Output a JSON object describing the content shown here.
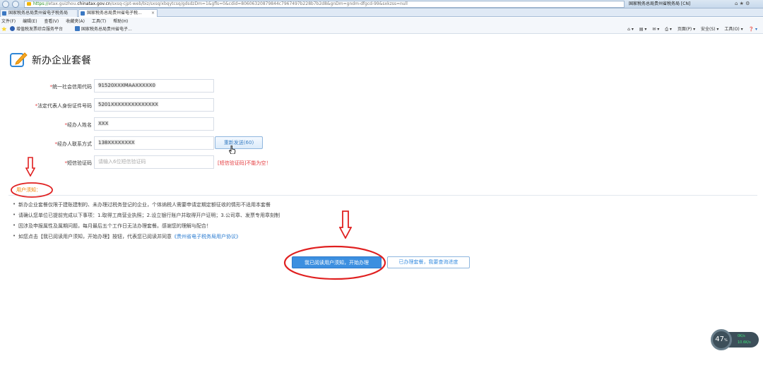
{
  "browser": {
    "url_scheme": "https://",
    "url_domain_prefix": "etax.guizhou.",
    "url_domain": "chinatax.gov.cn",
    "url_rest": "/sxsq-cjpt-web/biz/sxsq/xbqytcsq/gdsdzDm=1&gfls=0&cdid=80606320879844c7967497b228b7b2d8&gnDm=gndm-dfgcd-99&sxkzss=null",
    "site_name": "国家税务总局贵州省税务局 [CN]",
    "tabs": [
      {
        "label": "国家税务总局贵州省电子税务局"
      },
      {
        "label": "国家税务总局贵州省电子税..."
      }
    ],
    "menu": [
      "文件(F)",
      "编辑(E)",
      "查看(V)",
      "收藏夹(A)",
      "工具(T)",
      "帮助(H)"
    ],
    "favorites": [
      "增值税发票综合服务平台",
      "国家税务总局贵州省电子..."
    ],
    "commands": [
      "页面(P) ▾",
      "安全(S) ▾",
      "工具(O) ▾"
    ]
  },
  "page": {
    "title": "新办企业套餐",
    "fields": [
      {
        "label": "统一社会信用代码",
        "value": "91520XXXMAAXXXXX0"
      },
      {
        "label": "法定代表人身份证件号码",
        "value": "5201XXXXXXXXXXXXXX"
      },
      {
        "label": "经办人姓名",
        "value": "XXX"
      },
      {
        "label": "经办人联系方式",
        "value": "138XXXXXXXX"
      },
      {
        "label": "短信验证码",
        "value": "",
        "placeholder": "请输入6位短信验证码"
      }
    ],
    "required_mark": "*",
    "resend_button": "重新发送(60)",
    "sms_error": "[短信验证码]不能为空！",
    "notice_title": "用户须知：",
    "notices": [
      "新办企业套餐仅限于建账建制的、未办理过税务登记的企业，个体纳税人需要申请定期定额征收的情形不适用本套餐",
      "请确认您单位已提前完成以下事项：1.取得工商营业执照；2.设立银行账户并取得开户证明；3.公司章、发票专用章刻制",
      "因涉及申报属性及属期问题，每月最后五个工作日无法办理套餐。感谢您的理解与配合！"
    ],
    "notice_last_prefix": "如您点击【我已阅读用户须知，开始办理】按钮，代表您已阅读并同意",
    "notice_last_link": "《贵州省电子税务局用户协议》",
    "primary_button": "我已阅读用户须知，开始办理",
    "secondary_button": "已办理套餐，我要查询进度"
  },
  "widget": {
    "percent": "47",
    "percent_unit": "%",
    "up": "0K/s",
    "down": "10.6K/s"
  },
  "colors": {
    "accent": "#3c8fe0",
    "required": "#e4393c",
    "notice": "#f08200",
    "annotation": "#e02020"
  }
}
